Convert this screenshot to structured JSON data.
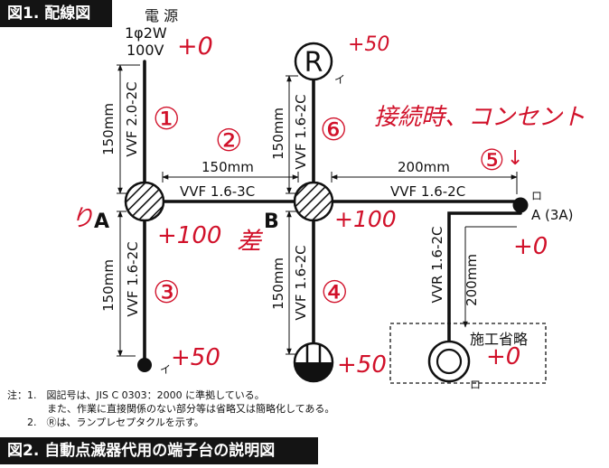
{
  "figure1": {
    "title": "図1. 配線図",
    "source": {
      "name": "電 源",
      "spec1": "1φ2W",
      "spec2": "100V"
    },
    "boxes": {
      "a": "A",
      "b": "B"
    },
    "dims": {
      "upper_left": "150mm",
      "top_mid": "150mm",
      "top_right": "200mm",
      "lower_left": "150mm",
      "lower_mid": "150mm",
      "lower_right": "200mm"
    },
    "cables": {
      "source": "VVF 2.0-2C",
      "a_b": "VVF 1.6-3C",
      "b_receptacle": "VVF 1.6-2C",
      "b_outlet": "VVF 1.6-2C",
      "a_down": "VVF 1.6-2C",
      "b_down": "VVF 1.6-2C",
      "outlet_down": "VVR 1.6-2C"
    },
    "receptacle_symbol": "R",
    "labels": {
      "i_top": "イ",
      "i_bottom": "イ",
      "ro_top": "ロ",
      "ro_bottom": "ロ",
      "outlet": "A (3A)"
    },
    "omit_label": "施工省略",
    "notes": [
      "注：1.　図記号は、JIS C 0303：2000 に準拠している。",
      "　　　　また、作業に直接関係のない部分等は省略又は簡略化してある。",
      "　　2.　Ⓡは、ランプレセプタクルを示す。"
    ]
  },
  "annotations": {
    "source_plus": "+0",
    "receptacle_plus": "+50",
    "outlet_header": "接続時、コンセント",
    "num_1": "①",
    "num_2": "②",
    "num_3": "③",
    "num_4": "④",
    "num_5": "⑤",
    "num_6": "⑥",
    "arrow_5": "↓",
    "ri": "り",
    "a_plus": "+100",
    "b_plus": "+100",
    "sa": "差",
    "outlet_plus": "+0",
    "lamp_a_plus": "+50",
    "lamp_b_plus": "+50",
    "omit_plus": "+0"
  },
  "figure2": {
    "title": "図2. 自動点滅器代用の端子台の説明図"
  },
  "colors": {
    "ink": "#111111",
    "annotation": "#d1112a",
    "titlebar": "#141414"
  }
}
